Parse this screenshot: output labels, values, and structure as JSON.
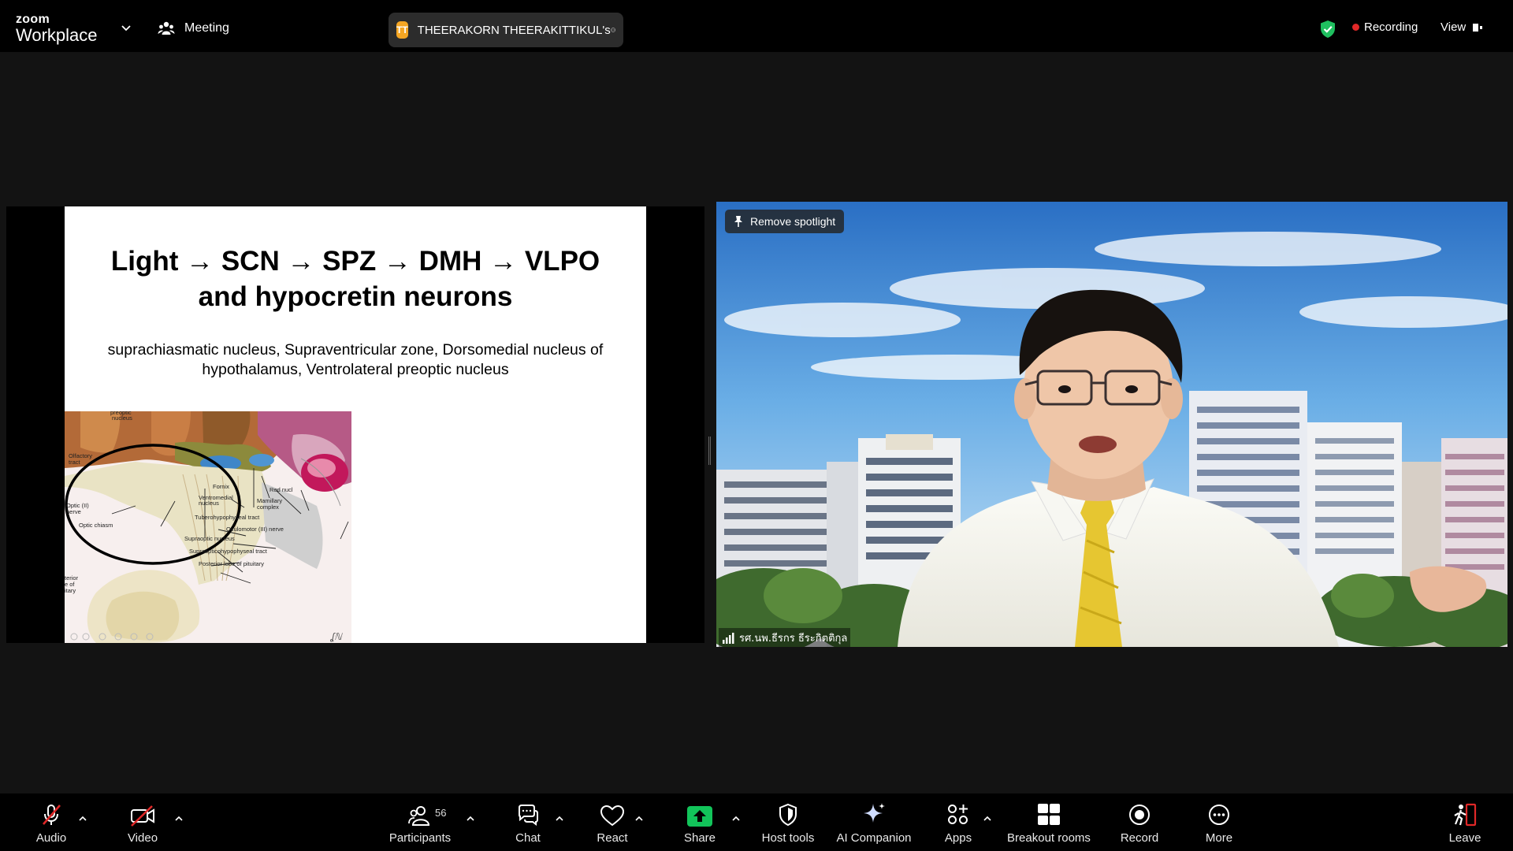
{
  "app": {
    "logo_top": "zoom",
    "logo_bottom": "Workplace",
    "meeting_label": "Meeting",
    "share_initials": "TT",
    "share_name": "THEERAKORN THEERAKITTIKUL's",
    "recording_label": "Recording",
    "view_label": "View"
  },
  "slide": {
    "title_line1": "Light → SCN → SPZ → DMH → VLPO",
    "title_line2": "and hypocretin neurons",
    "subtitle_line1": "suprachiasmatic nucleus, Supraventricular zone, Dorsomedial nucleus of",
    "subtitle_line2": "hypothalamus, Ventrolateral preoptic nucleus",
    "labels": {
      "preoptic": "preoptic",
      "nucleus_top": "nucleus",
      "olfactory": "Olfactory",
      "tract": "tract",
      "fornix": "Fornix",
      "ventromedial": "Ventromedial",
      "ventromedial_2": "nucleus",
      "red_nucleus": "Red nucl",
      "mamillary": "Mamillary",
      "complex": "complex",
      "optic_nerve": "Optic (II)",
      "optic_nerve_2": "nerve",
      "optic_chiasm": "Optic chiasm",
      "tuberohypophyseal": "Tuberohypophyseal tract",
      "oculomotor": "Oculomotor (III) nerve",
      "supraoptic": "Supraoptic nucleus",
      "supraopticohypophyseal": "Supraopticohypophyseal tract",
      "posterior_lobe": "Posterior lobe of pituitary",
      "anterior_1": "terior",
      "anterior_2": "e of",
      "anterior_3": "itary"
    }
  },
  "video": {
    "spotlight_label": "Remove spotlight",
    "participant_name": "รศ.นพ.ธีรกร ธีระกิตติกุล"
  },
  "toolbar": {
    "audio": "Audio",
    "video": "Video",
    "participants": "Participants",
    "participants_count": "56",
    "chat": "Chat",
    "react": "React",
    "share": "Share",
    "host_tools": "Host tools",
    "ai_companion": "AI Companion",
    "apps": "Apps",
    "breakout_rooms": "Breakout rooms",
    "record": "Record",
    "more": "More",
    "leave": "Leave"
  },
  "colors": {
    "accent_green": "#1fbf5f",
    "share_green": "#12c45a",
    "recording_red": "#e02828",
    "leave_red": "#e02828",
    "avatar_orange": "#f5a623"
  }
}
